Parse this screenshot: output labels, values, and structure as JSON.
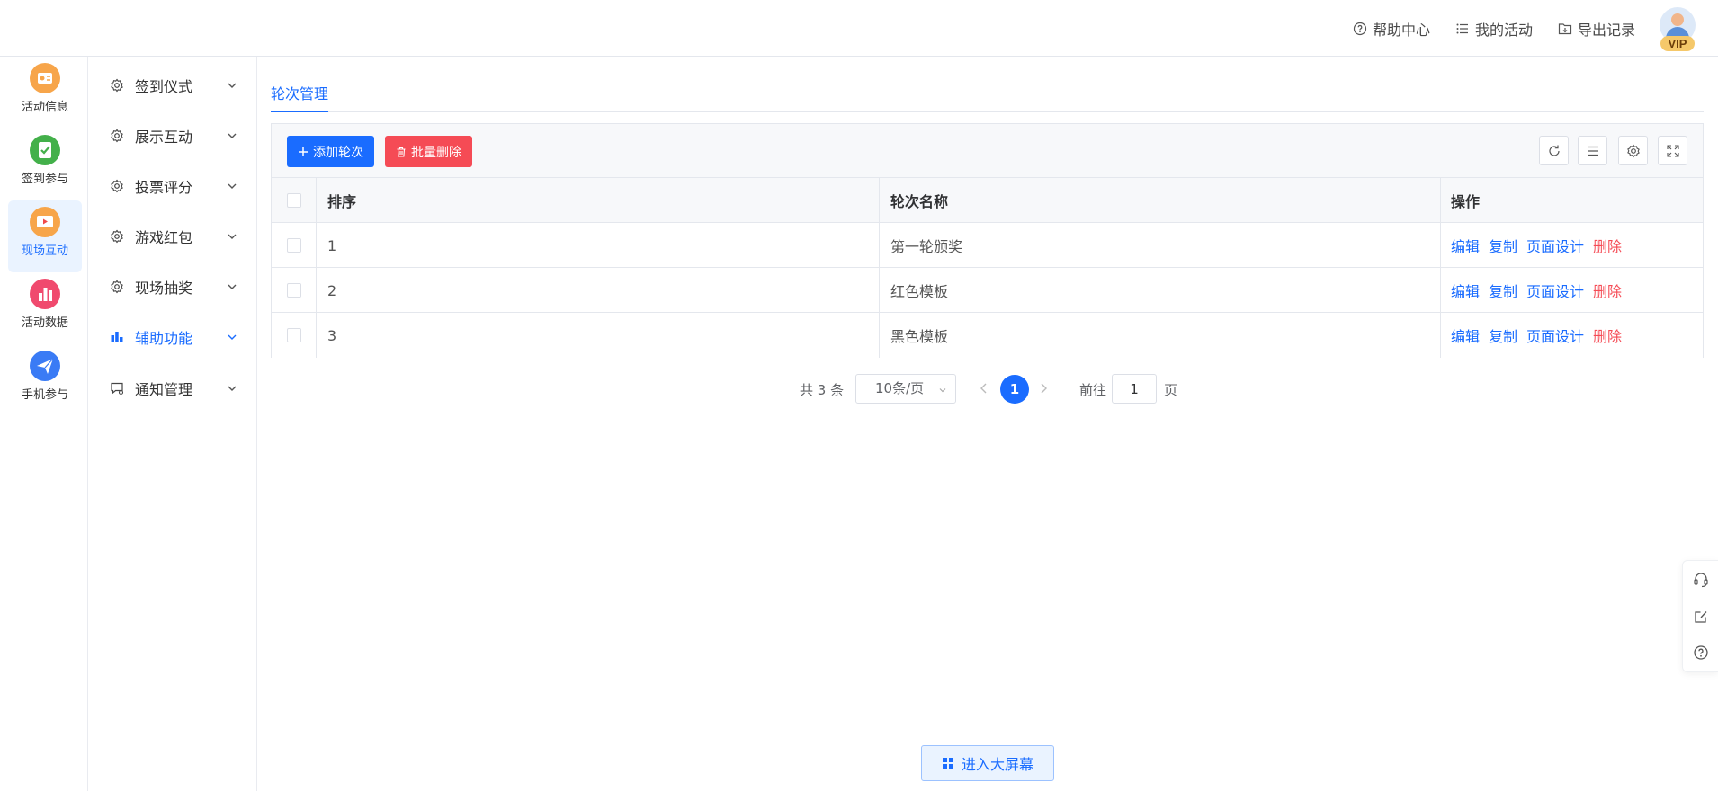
{
  "header": {
    "help_label": "帮助中心",
    "my_activity_label": "我的活动",
    "export_label": "导出记录",
    "vip_badge": "VIP"
  },
  "rail": {
    "items": [
      {
        "label": "活动信息",
        "icon": "activity-info-icon",
        "color": "#f7a54a"
      },
      {
        "label": "签到参与",
        "icon": "checkin-icon",
        "color": "#43b04a"
      },
      {
        "label": "现场互动",
        "icon": "live-interact-icon",
        "color": "#f7a54a",
        "active": true
      },
      {
        "label": "活动数据",
        "icon": "activity-data-icon",
        "color": "#f04a6e"
      },
      {
        "label": "手机参与",
        "icon": "mobile-join-icon",
        "color": "#3a7bf5"
      }
    ]
  },
  "submenu": {
    "items": [
      {
        "label": "签到仪式",
        "icon": "gear-icon"
      },
      {
        "label": "展示互动",
        "icon": "gear-icon"
      },
      {
        "label": "投票评分",
        "icon": "gear-icon"
      },
      {
        "label": "游戏红包",
        "icon": "gear-icon"
      },
      {
        "label": "现场抽奖",
        "icon": "gear-icon"
      },
      {
        "label": "辅助功能",
        "icon": "bar-chart-icon",
        "active": true
      },
      {
        "label": "通知管理",
        "icon": "notification-icon"
      }
    ]
  },
  "tabs": {
    "active_label": "轮次管理"
  },
  "toolbar": {
    "add_label": "添加轮次",
    "batch_delete_label": "批量删除"
  },
  "table": {
    "columns": {
      "order": "排序",
      "name": "轮次名称",
      "ops": "操作"
    },
    "rows": [
      {
        "order": "1",
        "name": "第一轮颁奖"
      },
      {
        "order": "2",
        "name": "红色模板"
      },
      {
        "order": "3",
        "name": "黑色模板"
      }
    ],
    "ops": {
      "edit": "编辑",
      "copy": "复制",
      "design": "页面设计",
      "delete": "删除"
    }
  },
  "pagination": {
    "total": "共 3 条",
    "page_size": "10条/页",
    "current_page": "1",
    "goto_label": "前往",
    "goto_value": "1",
    "page_suffix": "页"
  },
  "footer": {
    "big_screen_label": "进入大屏幕"
  },
  "colors": {
    "primary": "#1a6cff",
    "danger": "#f54b55"
  }
}
